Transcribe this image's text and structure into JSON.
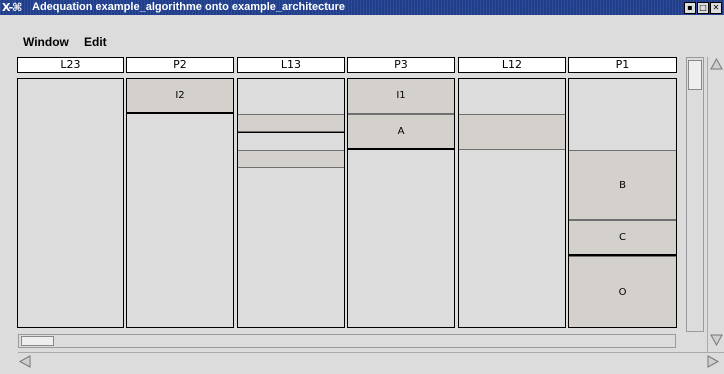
{
  "window": {
    "title": "Adequation example_algorithme onto example_architecture",
    "icon_glyph": "X-⌘"
  },
  "menu": [
    {
      "label": "Window"
    },
    {
      "label": "Edit"
    }
  ],
  "columns": [
    {
      "label": "L23"
    },
    {
      "label": "P2",
      "blocks": [
        {
          "label": "I2"
        }
      ]
    },
    {
      "label": "L13"
    },
    {
      "label": "P3",
      "blocks": [
        {
          "label": "I1"
        },
        {
          "label": "A"
        }
      ]
    },
    {
      "label": "L12"
    },
    {
      "label": "P1",
      "blocks": [
        {
          "label": "B"
        },
        {
          "label": "C"
        },
        {
          "label": "O"
        }
      ]
    }
  ],
  "icons": {
    "window_buttons": [
      "minimize-icon",
      "maximize-icon",
      "close-icon"
    ],
    "scroll": [
      "scroll-up-icon",
      "scroll-down-icon",
      "scroll-left-icon",
      "scroll-right-icon"
    ]
  }
}
